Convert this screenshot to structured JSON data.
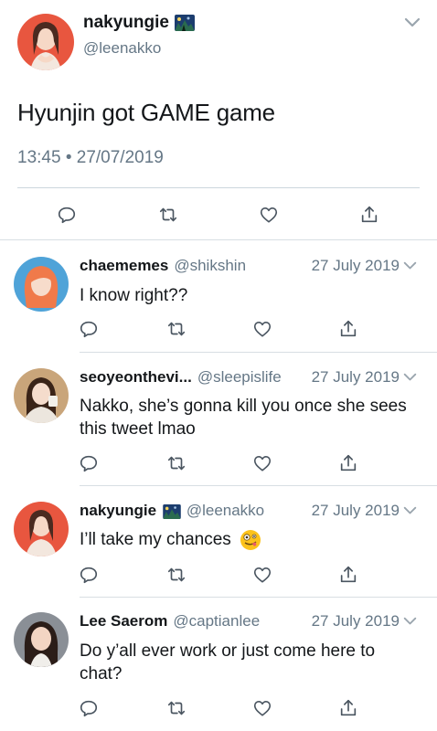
{
  "main_tweet": {
    "display_name": "nakyungie",
    "handle": "@leenakko",
    "text": "Hyunjin got GAME game",
    "timestamp": "13:45 • 27/07/2019",
    "avatar_icon": "avatar-photo",
    "badge_icon": "night-sky-picture-icon"
  },
  "replies": [
    {
      "display_name": "chaememes",
      "handle": "@shikshin",
      "date": "27 July 2019",
      "text": "I know right??"
    },
    {
      "display_name": "seoyeonthevi...",
      "handle": "@sleepislife",
      "date": "27 July 2019",
      "text": "Nakko, she’s gonna kill you once she sees this tweet lmao"
    },
    {
      "display_name": "nakyungie",
      "handle": "@leenakko",
      "date": "27 July 2019",
      "text": "I’ll take my chances",
      "emoji_icon": "zany-face-emoji"
    },
    {
      "display_name": "Lee Saerom",
      "handle": "@captianlee",
      "date": "27 July 2019",
      "text": "Do y’all ever work or just come here to chat?"
    }
  ],
  "colors": {
    "text_primary": "#14171a",
    "text_secondary": "#657786",
    "divider": "#ccd6dd",
    "icon": "#657786"
  }
}
